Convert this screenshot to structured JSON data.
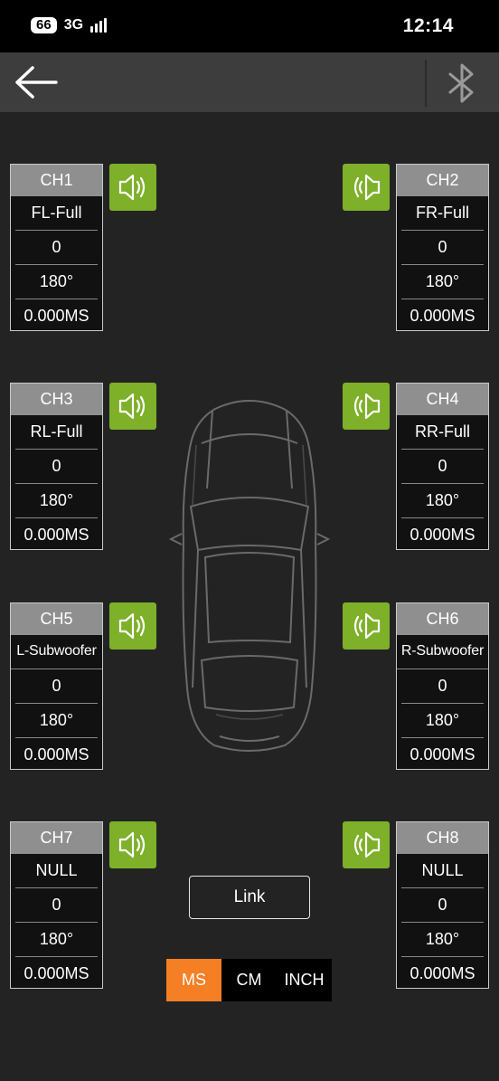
{
  "status_bar": {
    "battery": "66",
    "network": "3G",
    "time": "12:14"
  },
  "nav": {
    "back_icon": "arrow-left-icon",
    "bluetooth_icon": "bluetooth-icon"
  },
  "channels": [
    {
      "name": "CH1",
      "label": "FL-Full",
      "gain": "0",
      "phase": "180°",
      "delay": "0.000MS"
    },
    {
      "name": "CH2",
      "label": "FR-Full",
      "gain": "0",
      "phase": "180°",
      "delay": "0.000MS"
    },
    {
      "name": "CH3",
      "label": "RL-Full",
      "gain": "0",
      "phase": "180°",
      "delay": "0.000MS"
    },
    {
      "name": "CH4",
      "label": "RR-Full",
      "gain": "0",
      "phase": "180°",
      "delay": "0.000MS"
    },
    {
      "name": "CH5",
      "label": "L-Subwoofer",
      "gain": "0",
      "phase": "180°",
      "delay": "0.000MS"
    },
    {
      "name": "CH6",
      "label": "R-Subwoofer",
      "gain": "0",
      "phase": "180°",
      "delay": "0.000MS"
    },
    {
      "name": "CH7",
      "label": "NULL",
      "gain": "0",
      "phase": "180°",
      "delay": "0.000MS"
    },
    {
      "name": "CH8",
      "label": "NULL",
      "gain": "0",
      "phase": "180°",
      "delay": "0.000MS"
    }
  ],
  "link_label": "Link",
  "units": {
    "options": [
      "MS",
      "CM",
      "INCH"
    ],
    "selected": "MS"
  },
  "colors": {
    "accent_green": "#7eb02a",
    "accent_orange": "#f47f24",
    "background": "#232323",
    "navbar": "#3d3d3d"
  }
}
